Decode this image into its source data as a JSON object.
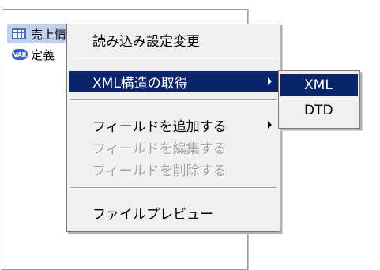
{
  "tree": {
    "rows": [
      {
        "icon": "table-icon",
        "label": "売上情報"
      },
      {
        "icon": "var-icon",
        "badge": "VAR",
        "label": "定義"
      }
    ]
  },
  "context_menu": {
    "items": [
      {
        "label": "読み込み設定変更",
        "state": "normal"
      },
      {
        "label": "XML構造の取得",
        "state": "highlighted",
        "submenu": true
      },
      {
        "label": "フィールドを追加する",
        "state": "normal",
        "submenu": true
      },
      {
        "label": "フィールドを編集する",
        "state": "disabled"
      },
      {
        "label": "フィールドを削除する",
        "state": "disabled"
      },
      {
        "label": "ファイルプレビュー",
        "state": "normal"
      }
    ]
  },
  "submenu": {
    "items": [
      {
        "label": "XML",
        "state": "highlighted"
      },
      {
        "label": "DTD",
        "state": "normal"
      }
    ]
  },
  "colors": {
    "menu_highlight": "#0a246a",
    "tree_selection": "#c1d2ee",
    "disabled_text": "#a0a0a0"
  }
}
